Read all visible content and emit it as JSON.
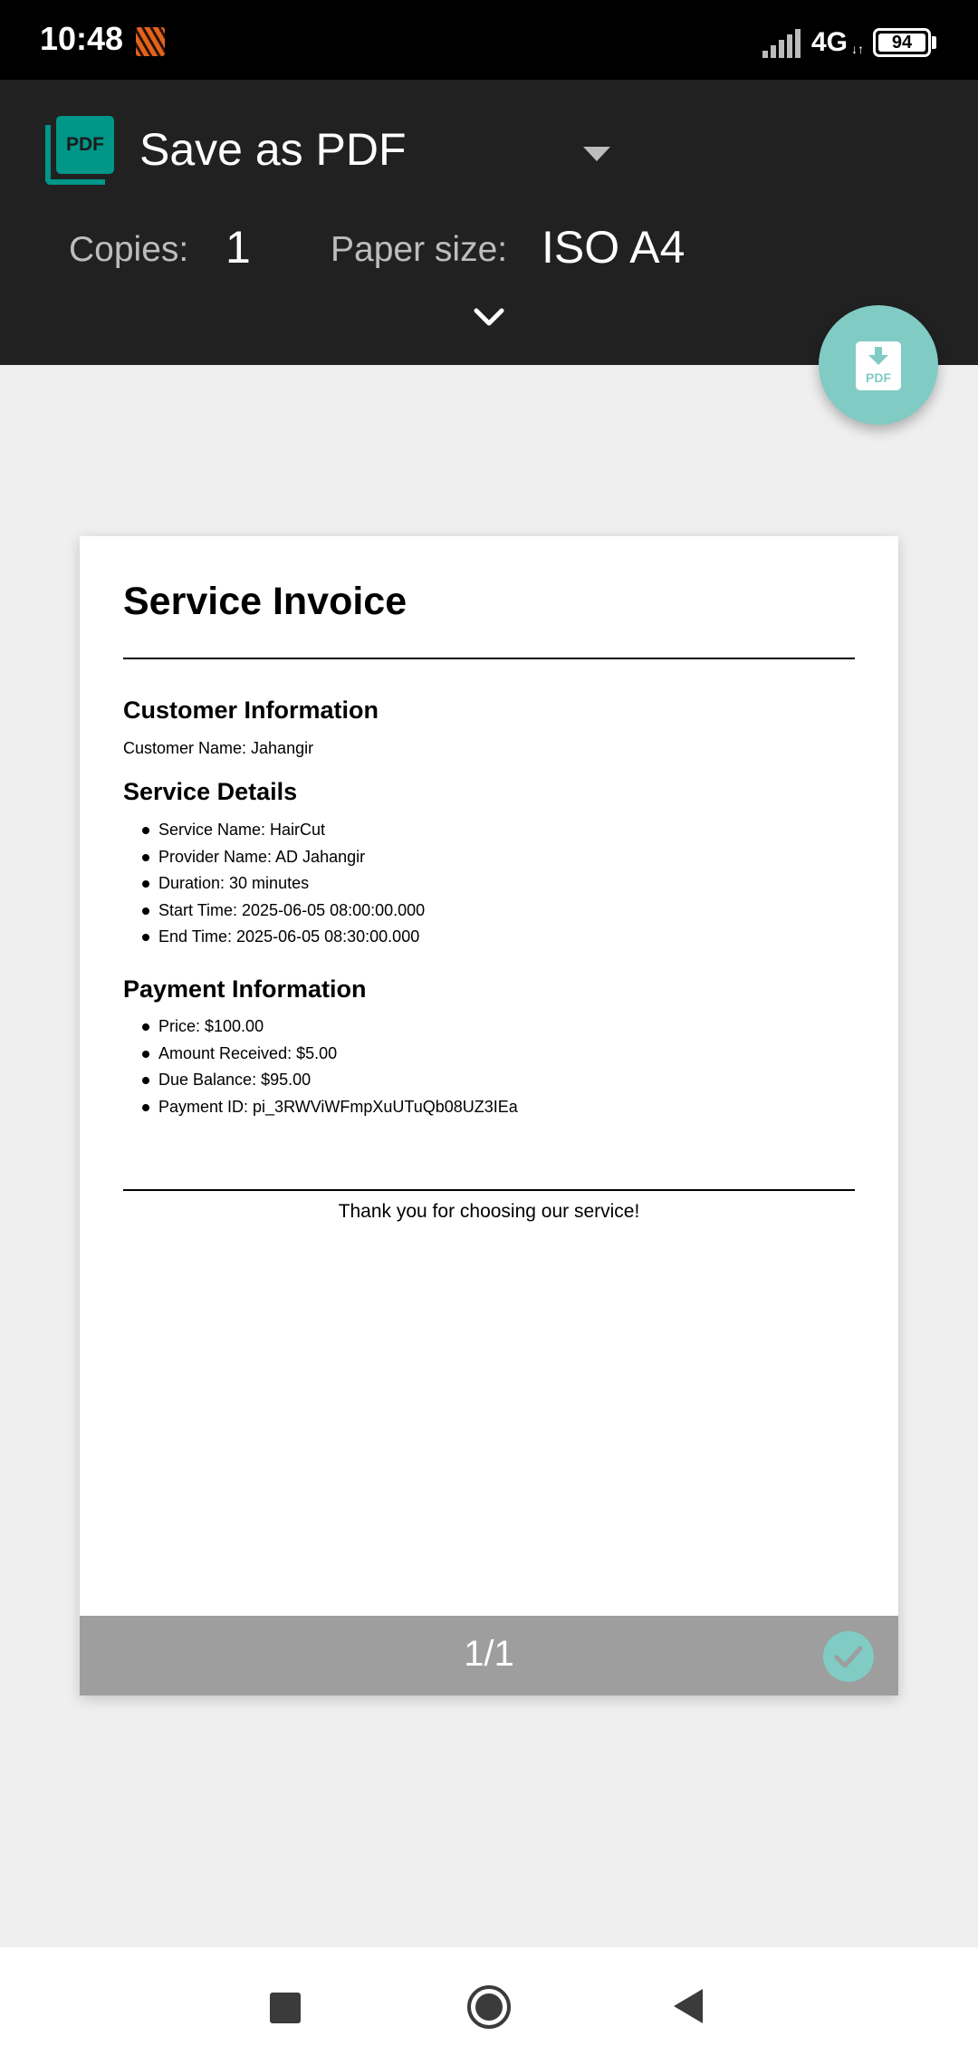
{
  "status_bar": {
    "time": "10:48",
    "network": "4G",
    "network_arrows": "↓↑",
    "battery_level": "94"
  },
  "header": {
    "printer_name": "Save as PDF",
    "logo_text": "PDF",
    "copies_label": "Copies:",
    "copies_value": "1",
    "paper_size_label": "Paper size:",
    "paper_size_value": "ISO A4",
    "fab_icon_text": "PDF"
  },
  "document": {
    "title": "Service Invoice",
    "customer_section": {
      "heading": "Customer Information",
      "customer_name": "Customer Name: Jahangir"
    },
    "service_section": {
      "heading": "Service Details",
      "items": [
        "Service Name: HairCut",
        "Provider Name: AD Jahangir",
        "Duration: 30 minutes",
        "Start Time: 2025-06-05 08:00:00.000",
        "End Time: 2025-06-05 08:30:00.000"
      ]
    },
    "payment_section": {
      "heading": "Payment Information",
      "items": [
        "Price: $100.00",
        "Amount Received: $5.00",
        "Due Balance: $95.00",
        "Payment ID: pi_3RWViWFmpXuUTuQb08UZ3IEa"
      ]
    },
    "footer_note": "Thank you for choosing our service!"
  },
  "page_footer": {
    "page_indicator": "1/1"
  },
  "colors": {
    "accent": "#009688",
    "fab": "#80cbc4",
    "header_bg": "#212121"
  },
  "icons": {
    "dropdown": "triangle-down-icon",
    "expand": "chevron-down-icon",
    "fab": "pdf-download-icon",
    "page_selected": "check-icon"
  }
}
